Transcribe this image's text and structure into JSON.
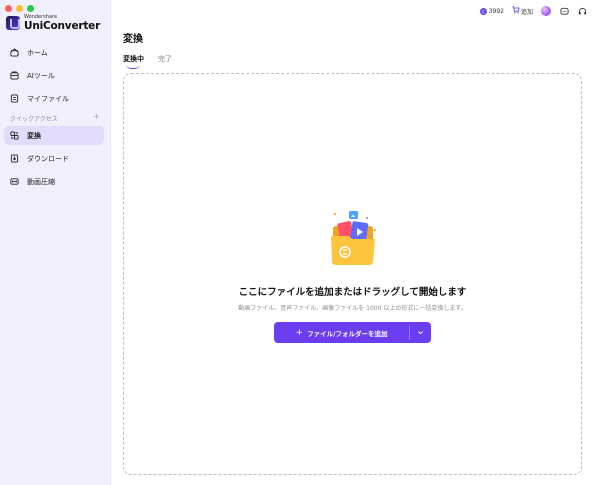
{
  "brand": {
    "top": "Wondershare",
    "name": "UniConverter"
  },
  "sidebar": {
    "items": [
      {
        "label": "ホーム",
        "icon": "home-icon"
      },
      {
        "label": "AIツール",
        "icon": "ai-tools-icon"
      },
      {
        "label": "マイファイル",
        "icon": "my-files-icon"
      }
    ],
    "section_label": "クイックアクセス",
    "section_add": "+",
    "quick_items": [
      {
        "label": "変換",
        "icon": "convert-icon",
        "active": true
      },
      {
        "label": "ダウンロード",
        "icon": "download-icon"
      },
      {
        "label": "動画圧縮",
        "icon": "compress-icon"
      }
    ]
  },
  "topbar": {
    "credits": "3992",
    "add_label": "追加"
  },
  "main": {
    "title": "変換",
    "tabs": [
      {
        "label": "変換中"
      },
      {
        "label": "完了"
      }
    ],
    "drop_title": "ここにファイルを追加またはドラッグして開始します",
    "drop_subtitle": "動画ファイル、音声ファイル、画像ファイルを 1000 以上の形式に一括変換します。",
    "add_button": "ファイル/フォルダーを追加"
  },
  "colors": {
    "accent": "#6b3df1",
    "sidebar_bg": "#f1effb",
    "active_bg": "#e2dbfb"
  }
}
